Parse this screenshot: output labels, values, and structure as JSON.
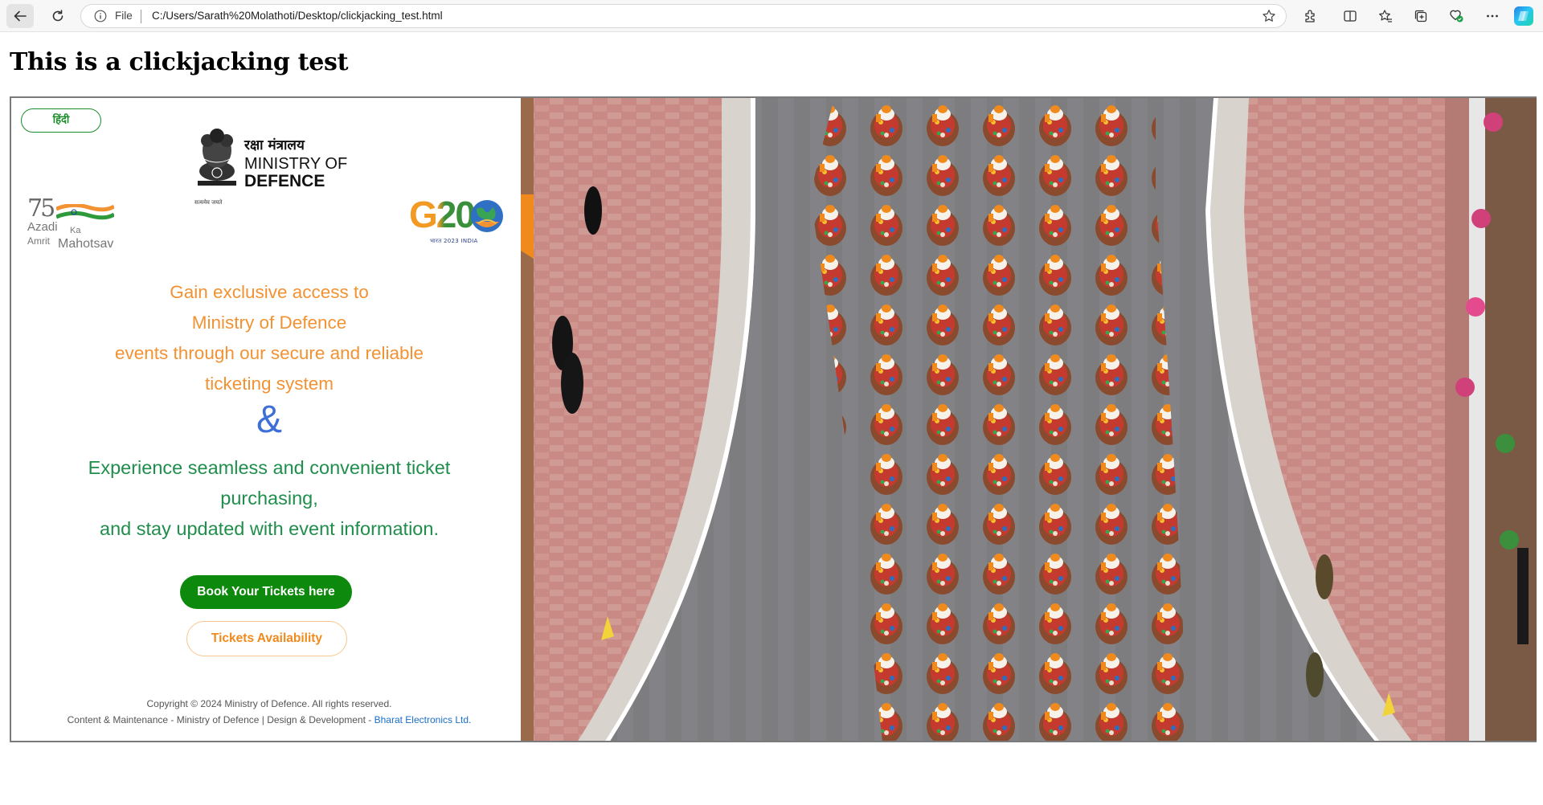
{
  "browser": {
    "scheme_label": "File",
    "url": "C:/Users/Sarath%20Molathoti/Desktop/clickjacking_test.html",
    "icons": [
      "back-icon",
      "refresh-icon",
      "info-icon",
      "favorite-star-icon",
      "extensions-icon",
      "split-screen-icon",
      "favorites-icon",
      "collections-icon",
      "browser-essentials-icon",
      "more-icon",
      "copilot-icon"
    ]
  },
  "page": {
    "heading": "This is a clickjacking test"
  },
  "frame": {
    "lang_toggle": "हिंदी",
    "ministry": {
      "hindi": "रक्षा मंत्रालय",
      "line1": "MINISTRY OF",
      "line2": "DEFENCE",
      "motto": "सत्यमेव जयते"
    },
    "aka_logo": {
      "number": "75",
      "azadi": "Azadi",
      "ka": "Ka",
      "amrit": "Amrit",
      "mahotsav": "Mahotsav"
    },
    "g20_logo": {
      "text": "G20",
      "sub": "भारत 2023 INDIA"
    },
    "intro_lines": [
      "Gain exclusive access to",
      "Ministry of Defence",
      "events through our secure and reliable",
      "ticketing system"
    ],
    "ampersand": "&",
    "experience_lines": [
      "Experience seamless and convenient ticket",
      "purchasing,",
      "and stay updated with event information."
    ],
    "book_button": "Book Your Tickets here",
    "availability_button": "Tickets Availability",
    "copyright": "Copyright © 2024 Ministry of Defence. All rights reserved.",
    "credits_prefix": "Content & Maintenance - Ministry of Defence | Design & Development - ",
    "credits_link": "Bharat Electronics Ltd.",
    "colors": {
      "accent_orange": "#f29233",
      "accent_green": "#1f8e4c",
      "ampersand_blue": "#3e6fd8",
      "button_green": "#0d8a0d",
      "link_blue": "#1a6fc9"
    }
  }
}
